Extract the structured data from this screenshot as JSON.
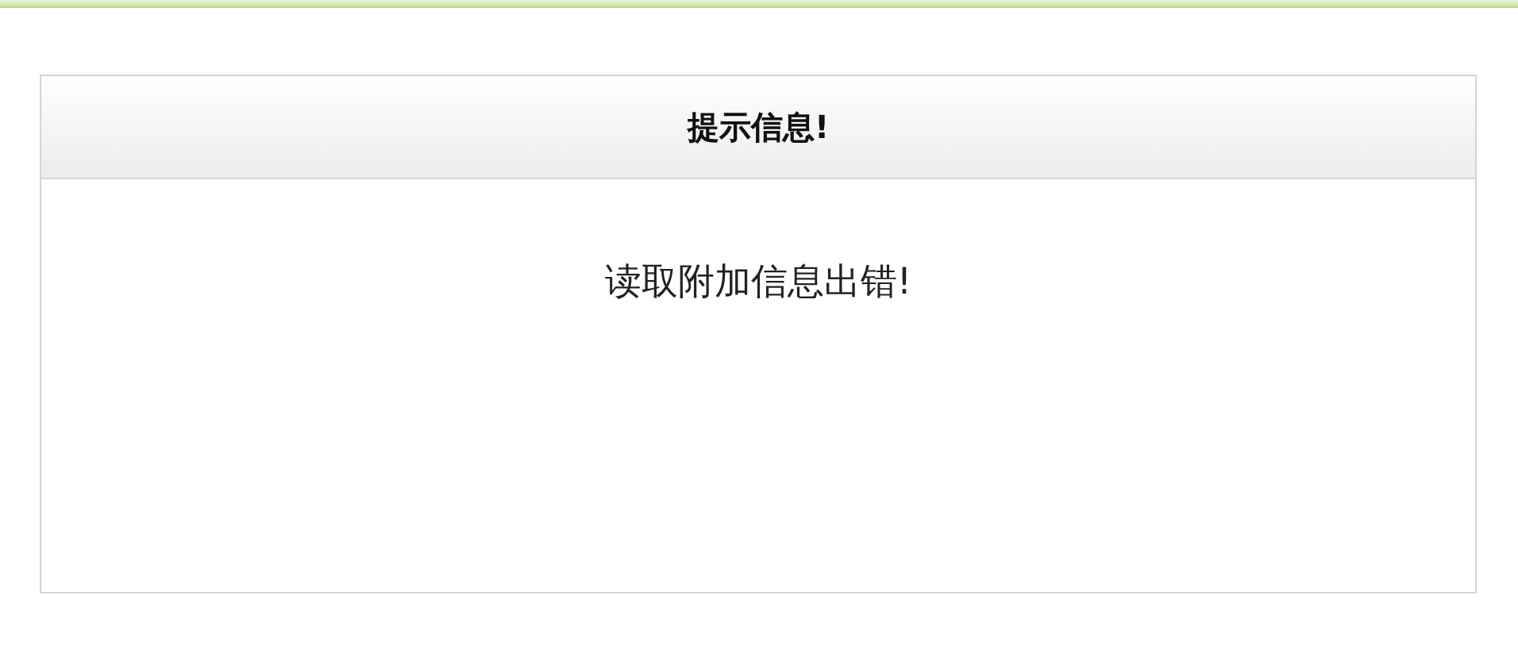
{
  "dialog": {
    "title": "提示信息!",
    "message": "读取附加信息出错!"
  }
}
